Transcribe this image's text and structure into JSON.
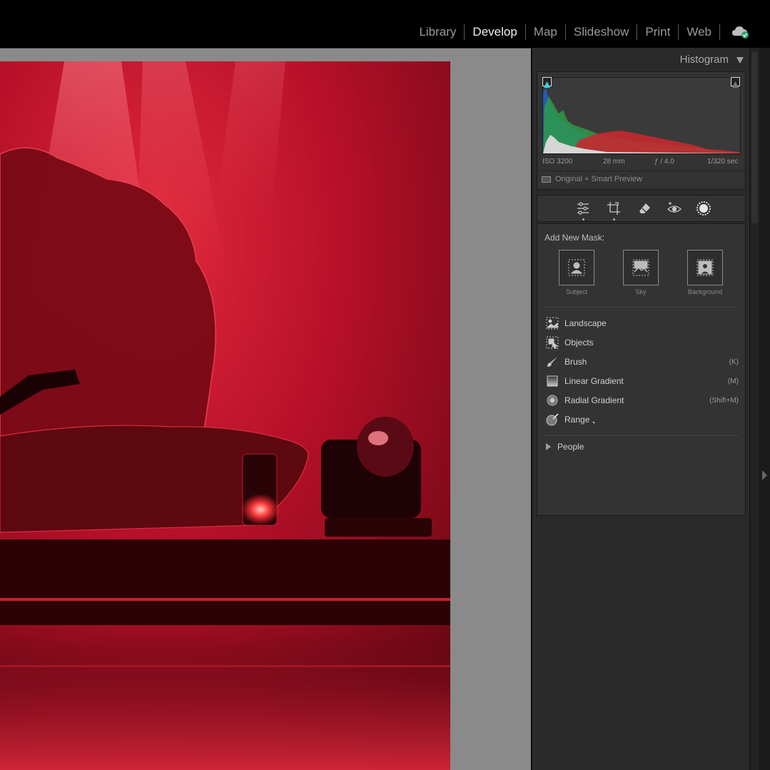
{
  "modules": [
    "Library",
    "Develop",
    "Map",
    "Slideshow",
    "Print",
    "Web"
  ],
  "active_module": "Develop",
  "histogram": {
    "title": "Histogram",
    "exif": {
      "iso": "ISO 3200",
      "focal": "28 mm",
      "aperture": "ƒ / 4.0",
      "shutter": "1/320 sec"
    },
    "preview_status": "Original + Smart Preview"
  },
  "toolstrip": {
    "tools": [
      "edit-sliders-icon",
      "crop-icon",
      "heal-eraser-icon",
      "red-eye-icon",
      "masking-icon"
    ],
    "active": "masking-icon"
  },
  "masking": {
    "add_new_label": "Add New Mask:",
    "quick_masks": [
      {
        "label": "Subject"
      },
      {
        "label": "Sky"
      },
      {
        "label": "Background"
      }
    ],
    "tools": [
      {
        "label": "Landscape",
        "shortcut": ""
      },
      {
        "label": "Objects",
        "shortcut": ""
      },
      {
        "label": "Brush",
        "shortcut": "(K)"
      },
      {
        "label": "Linear Gradient",
        "shortcut": "(M)"
      },
      {
        "label": "Radial Gradient",
        "shortcut": "(Shift+M)"
      },
      {
        "label": "Range",
        "shortcut": ""
      }
    ],
    "people_label": "People"
  },
  "colors": {
    "panel_bg": "#2a2a2a",
    "canvas_bg": "#8a8a8a",
    "photo_red": "#c4122a"
  }
}
